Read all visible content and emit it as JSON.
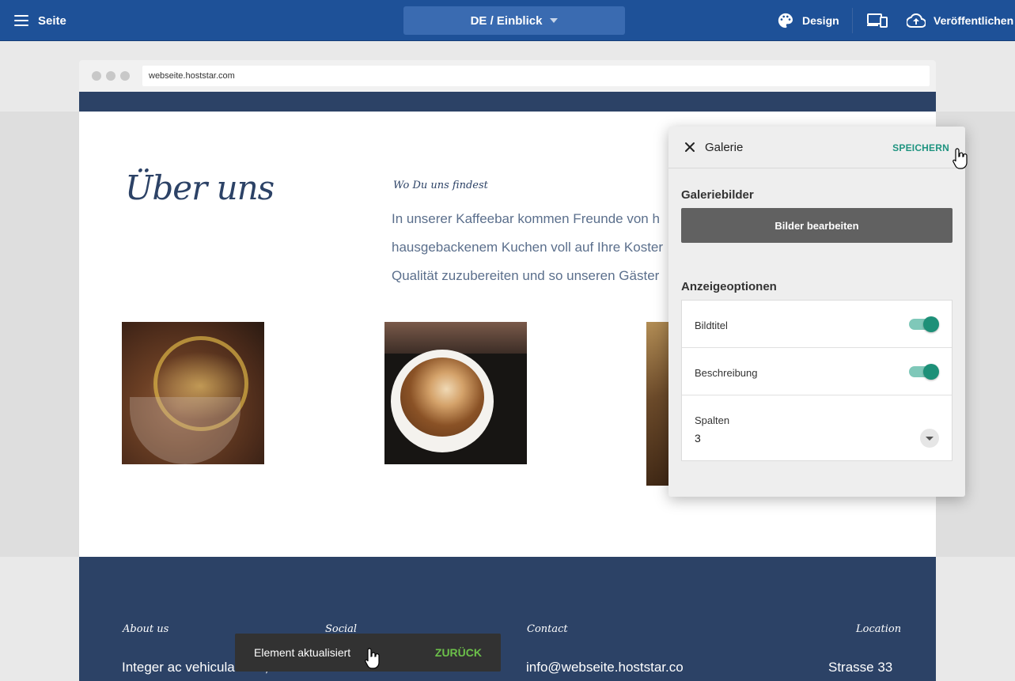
{
  "topbar": {
    "menu_label": "Seite",
    "language_selector": "DE / Einblick",
    "design_label": "Design",
    "publish_label": "Veröffentlichen"
  },
  "browser": {
    "url": "webseite.hoststar.com"
  },
  "page": {
    "heading": "Über uns",
    "subheading": "Wo Du uns findest",
    "body_lines": [
      "In unserer Kaffeebar kommen Freunde von h",
      "hausgebackenem Kuchen voll auf Ihre Koster",
      "Qualität zuzubereiten und so unseren Gäster"
    ]
  },
  "footer": {
    "about": {
      "heading": "About us",
      "value": "Integer ac vehicula eros,"
    },
    "social": {
      "heading": "Social"
    },
    "contact": {
      "heading": "Contact",
      "value": "info@webseite.hoststar.co"
    },
    "location": {
      "heading": "Location",
      "value": "Strasse 33"
    }
  },
  "snackbar": {
    "message": "Element aktualisiert",
    "action": "ZURÜCK"
  },
  "panel": {
    "title": "Galerie",
    "save_label": "SPEICHERN",
    "gallery_section": "Galeriebilder",
    "edit_images_button": "Bilder bearbeiten",
    "display_section": "Anzeigeoptionen",
    "options": [
      {
        "label": "Bildtitel",
        "enabled": true
      },
      {
        "label": "Beschreibung",
        "enabled": true
      }
    ],
    "columns": {
      "label": "Spalten",
      "value": "3"
    }
  },
  "colors": {
    "topbar": "#1e5198",
    "accent": "#1d9078",
    "site_navy": "#2c4266",
    "snackbar_action": "#6cc04a"
  }
}
